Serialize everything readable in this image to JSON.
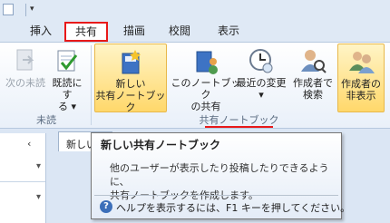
{
  "tabs": [
    {
      "label": "挿入"
    },
    {
      "label": "共有"
    },
    {
      "label": "描画"
    },
    {
      "label": "校閲"
    },
    {
      "label": "表示"
    }
  ],
  "ribbon": {
    "unread_group": {
      "label": "未読",
      "buttons": [
        {
          "label": "次の未読",
          "icon": "next-unread-icon",
          "disabled": true
        },
        {
          "label_line1": "既読にす",
          "label_line2": "る ▾",
          "icon": "mark-read-icon"
        }
      ]
    },
    "shared_group": {
      "label": "共有ノートブック",
      "buttons": [
        {
          "label_line1": "新しい",
          "label_line2": "共有ノートブック",
          "icon": "new-shared-notebook-icon",
          "highlighted": true
        },
        {
          "label_line1": "このノートブック",
          "label_line2": "の共有",
          "icon": "share-notebook-icon"
        },
        {
          "label_line1": "最近の変更",
          "label_line2": "▾",
          "icon": "recent-changes-icon"
        },
        {
          "label_line1": "作成者で",
          "label_line2": "検索",
          "icon": "find-by-author-icon"
        },
        {
          "label_line1": "作成者の",
          "label_line2": "非表示",
          "icon": "hide-authors-icon",
          "highlighted": true
        }
      ]
    }
  },
  "page_tab": {
    "label": "新しい"
  },
  "tooltip": {
    "title": "新しい共有ノートブック",
    "body_line1": "他のユーザーが表示したり投稿したりできるように、",
    "body_line2": "共有ノートブックを作成します。",
    "help": "ヘルプを表示するには、F1 キーを押してください。"
  },
  "colors": {
    "highlight": "#e81919",
    "ribbon_hover": "#ffd86b",
    "accent": "#3c6fb9"
  }
}
